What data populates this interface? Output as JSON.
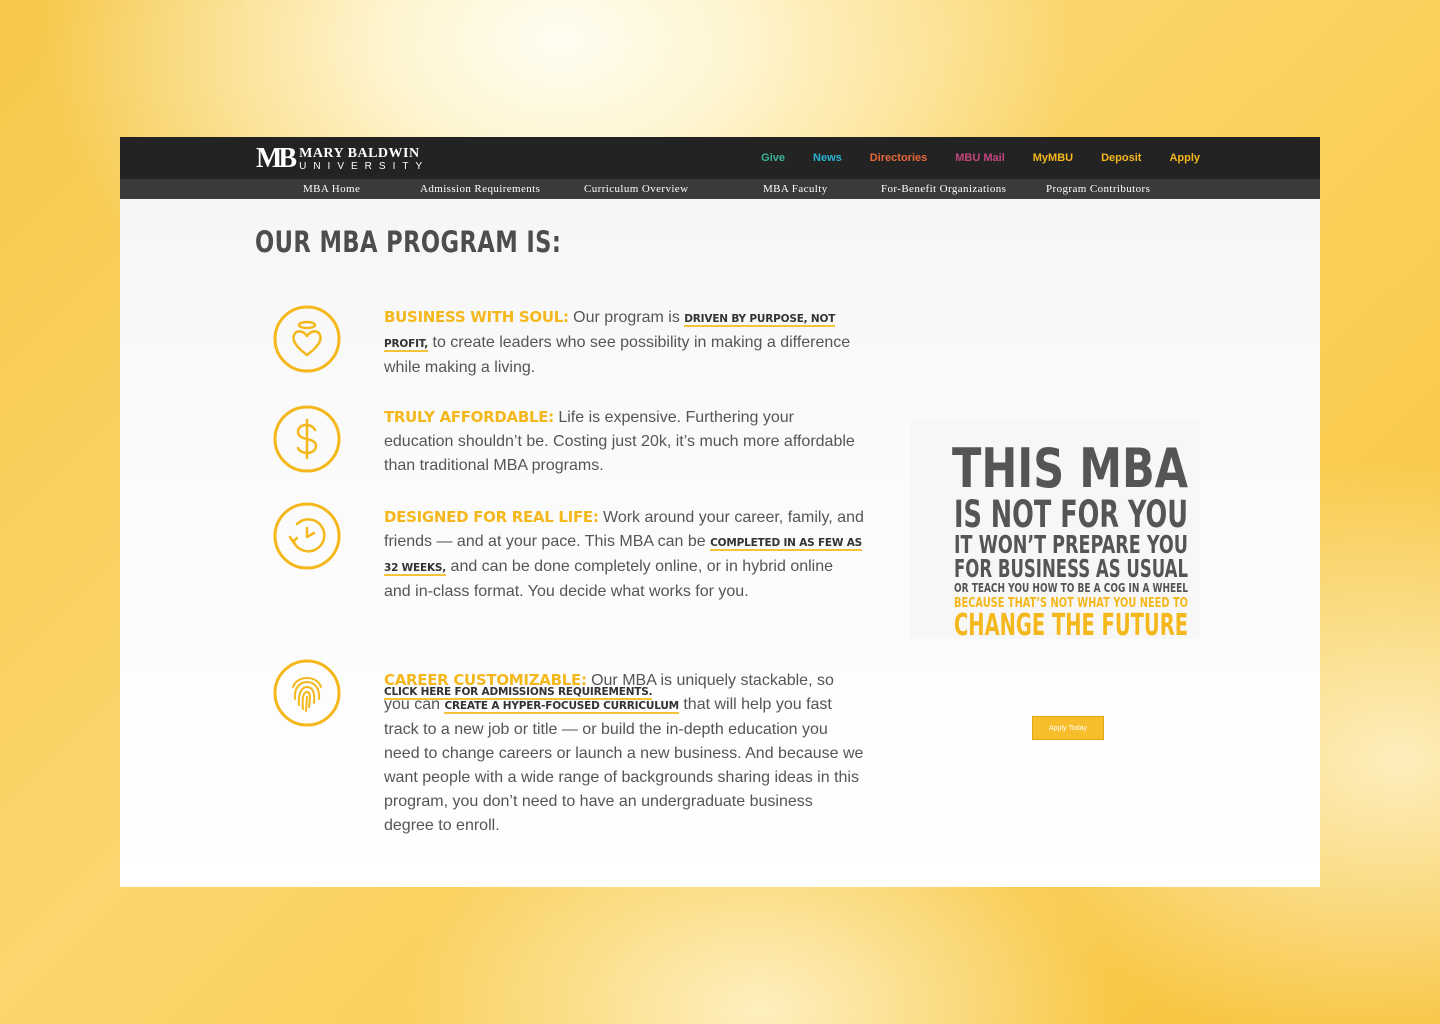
{
  "header": {
    "logo_mark": "MB",
    "logo_line1": "MARY BALDWIN",
    "logo_line2": "UNIVERSITY",
    "links": [
      {
        "label": "Give",
        "color": "#3db39e"
      },
      {
        "label": "News",
        "color": "#27b2d5"
      },
      {
        "label": "Directories",
        "color": "#e8673c"
      },
      {
        "label": "MBU Mail",
        "color": "#c2467d"
      },
      {
        "label": "MyMBU",
        "color": "#f5b81c"
      },
      {
        "label": "Deposit",
        "color": "#f5b81c"
      },
      {
        "label": "Apply",
        "color": "#f5b81c"
      }
    ]
  },
  "subnav": {
    "items": [
      "MBA Home",
      "Admission Requirements",
      "Curriculum Overview",
      "MBA Faculty",
      "For-Benefit Organizations",
      "Program Contributors"
    ]
  },
  "main": {
    "title": "OUR MBA PROGRAM IS:",
    "features": [
      {
        "icon": "heart-halo-icon",
        "title": "BUSINESS WITH SOUL:",
        "t1": " Our program is ",
        "hl1": "DRIVEN BY PURPOSE, NOT PROFIT,",
        "t2": " to create leaders who see possibility in making a difference while making a living."
      },
      {
        "icon": "dollar-icon",
        "title": "TRULY AFFORDABLE:",
        "t1": " Life is expensive. Furthering your education shouldn’t be. Costing just 20k, it’s much more affordable than traditional MBA programs."
      },
      {
        "icon": "clock-icon",
        "title": "DESIGNED FOR REAL LIFE:",
        "t1": " Work around your career, family, and friends — and at your pace. This MBA can be ",
        "hl1": "COMPLETED IN AS FEW AS 32 WEEKS,",
        "t2": " and can be done completely online, or in hybrid online and in-class format. You decide what works for you."
      },
      {
        "icon": "fingerprint-icon",
        "title": "CAREER CUSTOMIZABLE:",
        "t1": " Our MBA is uniquely stackable, so you can ",
        "hl1": "CREATE A HYPER-FOCUSED CURRICULUM",
        "t2": " that will help you fast track to a new job or title — or build the in-depth education you need to change careers or launch a new business. And because we want people with a wide range of backgrounds sharing ideas in this program, you don’t need to have an undergraduate business degree to enroll."
      }
    ],
    "admissions_link": "CLICK HERE FOR ADMISSIONS REQUIREMENTS."
  },
  "poster": {
    "line1": "THIS MBA",
    "line2": "IS NOT FOR YOU",
    "line3": "IT WON’T PREPARE YOU",
    "line4": "FOR BUSINESS AS USUAL",
    "line5": "OR TEACH YOU HOW TO BE A COG IN A WHEEL",
    "line6": "BECAUSE THAT’S NOT WHAT YOU NEED TO",
    "line7": "CHANGE THE FUTURE",
    "button": "Apply Today"
  },
  "colors": {
    "accent": "#f5b81c",
    "text": "#555555",
    "header_bg": "#232323",
    "subnav_bg": "#3a3a3a"
  }
}
